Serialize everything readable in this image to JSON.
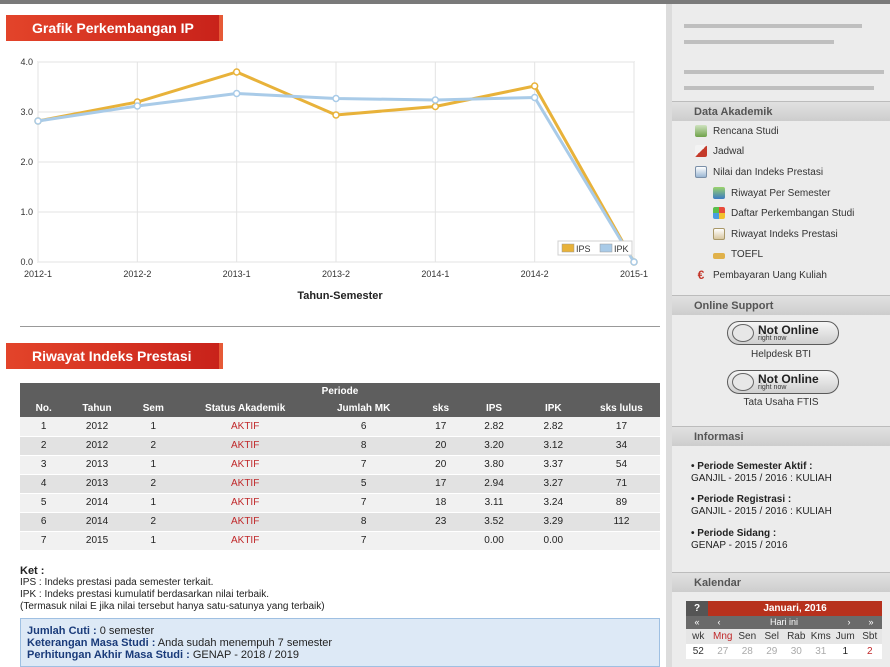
{
  "chart_section": {
    "title": "Grafik Perkembangan IP"
  },
  "chart_data": {
    "type": "line",
    "categories": [
      "2012-1",
      "2012-2",
      "2013-1",
      "2013-2",
      "2014-1",
      "2014-2",
      "2015-1"
    ],
    "series": [
      {
        "name": "IPS",
        "values": [
          2.82,
          3.2,
          3.8,
          2.94,
          3.11,
          3.52,
          0.0
        ],
        "color": "#e8b23a"
      },
      {
        "name": "IPK",
        "values": [
          2.82,
          3.12,
          3.37,
          3.27,
          3.24,
          3.29,
          0.0
        ],
        "color": "#a9cbe8"
      }
    ],
    "xlabel": "Tahun-Semester",
    "ylabel": "",
    "ylim": [
      0,
      4
    ],
    "yticks": [
      "0.0",
      "1.0",
      "2.0",
      "3.0",
      "4.0"
    ],
    "grid": true,
    "legend": "bottom-right"
  },
  "table_section": {
    "title": "Riwayat Indeks Prestasi",
    "group_header": "Periode",
    "columns": [
      "No.",
      "Tahun",
      "Sem",
      "Status Akademik",
      "Jumlah MK",
      "sks",
      "IPS",
      "IPK",
      "sks lulus"
    ],
    "rows": [
      [
        "1",
        "2012",
        "1",
        "AKTIF",
        "6",
        "17",
        "2.82",
        "2.82",
        "17"
      ],
      [
        "2",
        "2012",
        "2",
        "AKTIF",
        "8",
        "20",
        "3.20",
        "3.12",
        "34"
      ],
      [
        "3",
        "2013",
        "1",
        "AKTIF",
        "7",
        "20",
        "3.80",
        "3.37",
        "54"
      ],
      [
        "4",
        "2013",
        "2",
        "AKTIF",
        "5",
        "17",
        "2.94",
        "3.27",
        "71"
      ],
      [
        "5",
        "2014",
        "1",
        "AKTIF",
        "7",
        "18",
        "3.11",
        "3.24",
        "89"
      ],
      [
        "6",
        "2014",
        "2",
        "AKTIF",
        "8",
        "23",
        "3.52",
        "3.29",
        "112"
      ],
      [
        "7",
        "2015",
        "1",
        "AKTIF",
        "7",
        "",
        "0.00",
        "0.00",
        ""
      ]
    ]
  },
  "notes": {
    "heading": "Ket :",
    "ips": "IPS : Indeks prestasi pada semester terkait.",
    "ipk": "IPK : Indeks prestasi kumulatif berdasarkan nilai terbaik.",
    "extra": "(Termasuk nilai E jika nilai tersebut hanya satu-satunya yang terbaik)"
  },
  "summary": {
    "cuti_label": "Jumlah Cuti :",
    "cuti_value": " 0 semester",
    "ket_label": "Keterangan Masa Studi :",
    "ket_value": " Anda sudah menempuh 7 semester",
    "akhir_label": "Perhitungan Akhir Masa Studi :",
    "akhir_value": " GENAP - 2018 / 2019"
  },
  "sidebar": {
    "data_akademik": {
      "title": "Data Akademik",
      "items": [
        {
          "label": "Rencana Studi",
          "icon": "clipboard-icon"
        },
        {
          "label": "Jadwal",
          "icon": "calendar-pencil-icon"
        },
        {
          "label": "Nilai dan Indeks Prestasi",
          "icon": "grades-icon"
        }
      ],
      "subitems": [
        {
          "label": "Riwayat Per Semester",
          "icon": "flask-icon"
        },
        {
          "label": "Daftar Perkembangan Studi",
          "icon": "colorful-cube-icon"
        },
        {
          "label": "Riwayat Indeks Prestasi",
          "icon": "document-icon"
        },
        {
          "label": "TOEFL",
          "icon": "bar-icon"
        }
      ],
      "payment": {
        "label": "Pembayaran Uang Kuliah",
        "icon": "euro-icon"
      }
    },
    "online_support": {
      "title": "Online Support",
      "status_text": "Not Online",
      "status_sub": "right now",
      "agents": [
        "Helpdesk BTI",
        "Tata Usaha FTIS"
      ]
    },
    "informasi": {
      "title": "Informasi",
      "items": [
        {
          "label": "• Periode Semester Aktif :",
          "value": "GANJIL - 2015 / 2016 : KULIAH"
        },
        {
          "label": "• Periode Registrasi :",
          "value": "GANJIL - 2015 / 2016 : KULIAH"
        },
        {
          "label": "• Periode Sidang :",
          "value": "GENAP - 2015 / 2016"
        }
      ]
    },
    "kalendar": {
      "title": "Kalendar",
      "help": "?",
      "month": "Januari, 2016",
      "nav": [
        "«",
        "‹",
        "Hari ini",
        "›",
        "»"
      ],
      "headers": [
        "wk",
        "Mng",
        "Sen",
        "Sel",
        "Rab",
        "Kms",
        "Jum",
        "Sbt"
      ],
      "row1": [
        "52",
        "27",
        "28",
        "29",
        "30",
        "31",
        "1",
        "2"
      ]
    }
  }
}
